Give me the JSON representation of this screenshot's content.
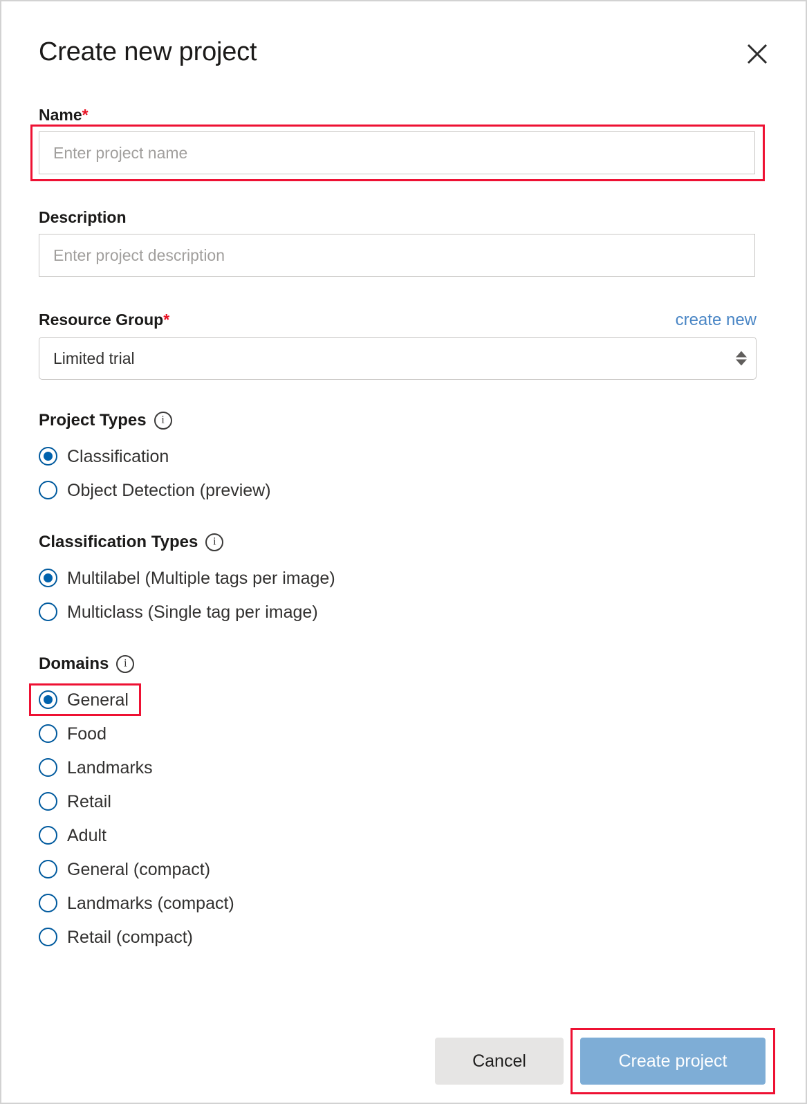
{
  "dialog": {
    "title": "Create new project",
    "close_icon": "close-icon"
  },
  "fields": {
    "name": {
      "label": "Name",
      "required_marker": "*",
      "placeholder": "Enter project name",
      "value": ""
    },
    "description": {
      "label": "Description",
      "placeholder": "Enter project description",
      "value": ""
    },
    "resource_group": {
      "label": "Resource Group",
      "required_marker": "*",
      "create_new_link": "create new",
      "selected": "Limited trial"
    }
  },
  "project_types": {
    "heading": "Project Types",
    "info_icon": "info-icon",
    "options": [
      {
        "label": "Classification",
        "checked": true
      },
      {
        "label": "Object Detection (preview)",
        "checked": false
      }
    ]
  },
  "classification_types": {
    "heading": "Classification Types",
    "info_icon": "info-icon",
    "options": [
      {
        "label": "Multilabel (Multiple tags per image)",
        "checked": true
      },
      {
        "label": "Multiclass (Single tag per image)",
        "checked": false
      }
    ]
  },
  "domains": {
    "heading": "Domains",
    "info_icon": "info-icon",
    "options": [
      {
        "label": "General",
        "checked": true,
        "highlighted": true
      },
      {
        "label": "Food",
        "checked": false
      },
      {
        "label": "Landmarks",
        "checked": false
      },
      {
        "label": "Retail",
        "checked": false
      },
      {
        "label": "Adult",
        "checked": false
      },
      {
        "label": "General (compact)",
        "checked": false
      },
      {
        "label": "Landmarks (compact)",
        "checked": false
      },
      {
        "label": "Retail (compact)",
        "checked": false
      }
    ]
  },
  "footer": {
    "cancel_label": "Cancel",
    "create_label": "Create project"
  },
  "colors": {
    "highlight_red": "#ee1133",
    "required_red": "#e81123",
    "link_blue": "#4a86c5",
    "radio_blue": "#005a9e",
    "primary_button": "#7eadd6",
    "cancel_button": "#e6e5e4"
  }
}
